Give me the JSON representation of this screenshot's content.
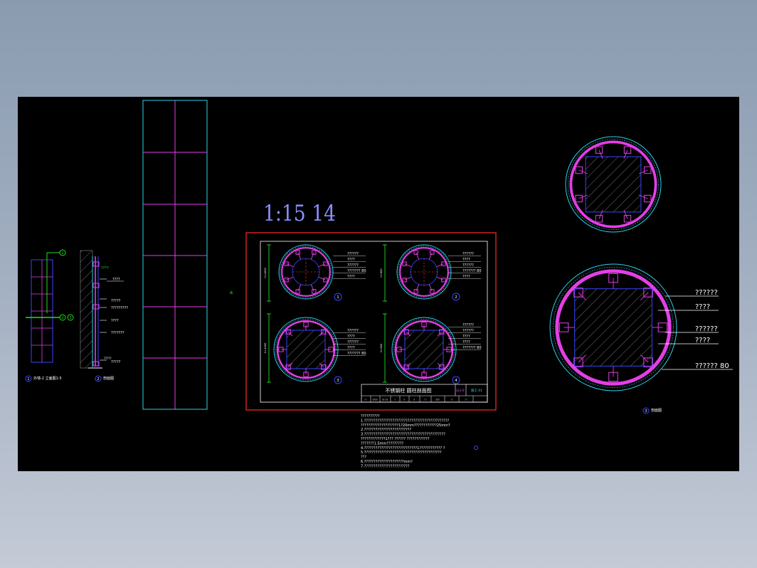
{
  "colors": {
    "background": "#000000",
    "frame": "#ff2a2a",
    "cyan": "#29d3e6",
    "magenta": "#e23fe6",
    "blue": "#3a44ff",
    "white": "#ffffff",
    "green": "#22dd22",
    "scale": "#8a8fff"
  },
  "scale_label": "1:15  14",
  "small_mark": "±",
  "left_views": {
    "view1_label": "外墙-2 立面图1:5",
    "view2_label": "剖面图",
    "view1_num": "1",
    "view2_num": "2",
    "balloon_a": "1",
    "balloon_b": "2",
    "balloon_c": "3",
    "section_notes": [
      "????",
      "?????",
      "?????????",
      "????",
      "???????",
      "?????"
    ],
    "section_top_note": "????",
    "section_bottom_note": "?????"
  },
  "sheet": {
    "num_labels": [
      "1",
      "2",
      "3",
      "4"
    ],
    "dim_labels": [
      "H=1000",
      "H=900",
      "H=1000",
      "H=900"
    ],
    "notes_1": [
      "??????",
      "????",
      "??????",
      "???????  80",
      "????"
    ],
    "notes_2": [
      "??????",
      "????",
      "??????",
      "???????  80",
      "????"
    ],
    "notes_3": [
      "??????",
      "????",
      "??????",
      "????",
      "???????  80"
    ],
    "notes_4": [
      "??????",
      "??????",
      "????",
      "????",
      "???????  80"
    ],
    "title": "不锈钢柱 圆柱剖面图",
    "title_block_code": "设计号",
    "title_block_no": "施工-01",
    "title_block_cells": [
      "??",
      "????",
      "?? ??",
      "?",
      "?",
      "?",
      "??",
      "???",
      "?",
      "??"
    ]
  },
  "general_notes": [
    "??????????",
    "1.?????????????????????????????????????????????",
    "  ????????????????????1?20mm????????????25mm?",
    "2.?????????????????????????",
    "3.???????????????????????????????????????????",
    "  ?????????????1???   ??????  ????????????",
    "  ???????1.5mm?????????",
    "4.????????????????????????????1????????????  ?",
    "5.?????????????????????????????????????????",
    "  ???",
    "6.?????????????????????mm?",
    "7.????????????????????????"
  ],
  "big_section": {
    "notes": [
      "??????",
      "????",
      "??????",
      "????",
      "??????  80"
    ],
    "view_label": "剖面图",
    "view_num": "3"
  }
}
